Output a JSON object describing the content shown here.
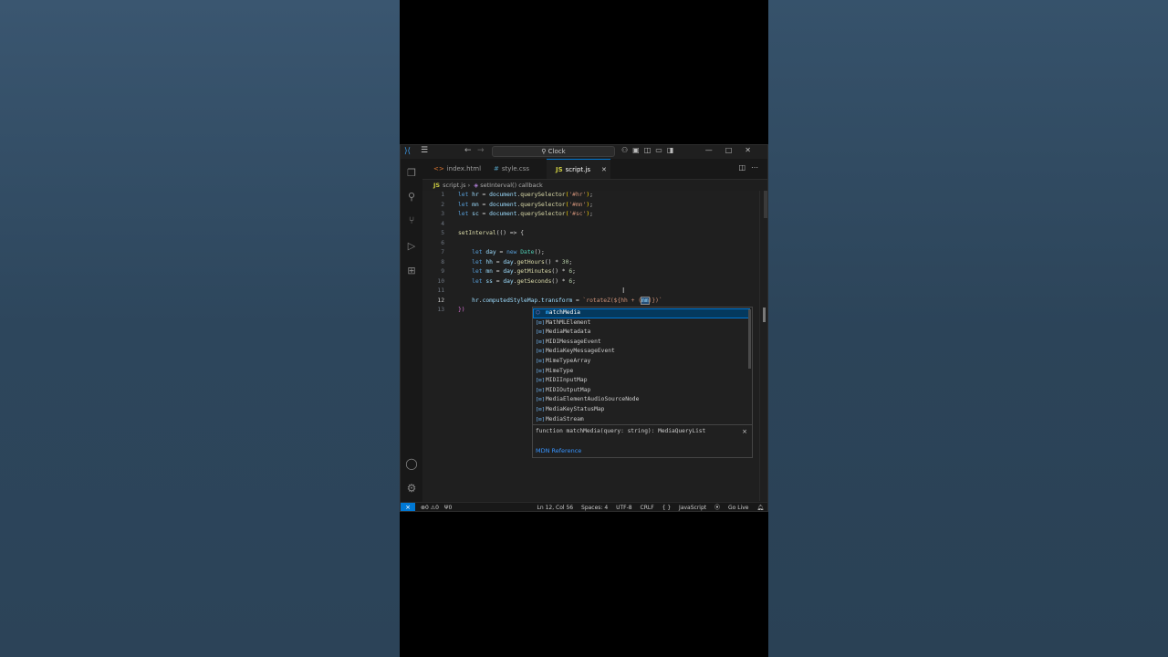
{
  "titlebar": {
    "search_text": "Clock",
    "icons": [
      "vscode-logo",
      "menu-icon",
      "back-arrow",
      "forward-arrow",
      "copilot-icon",
      "layout-icons",
      "window-controls"
    ]
  },
  "tabs": [
    {
      "label": "index.html",
      "glyph": "<>",
      "active": false
    },
    {
      "label": "style.css",
      "glyph": "#",
      "active": false
    },
    {
      "label": "script.js",
      "glyph": "JS",
      "active": true
    }
  ],
  "breadcrumb": {
    "file": "script.js",
    "file_badge": "JS",
    "symbol": "setInterval() callback"
  },
  "editor": {
    "lines": [
      {
        "n": "1"
      },
      {
        "n": "2"
      },
      {
        "n": "3"
      },
      {
        "n": "4"
      },
      {
        "n": "5"
      },
      {
        "n": "6"
      },
      {
        "n": "7"
      },
      {
        "n": "8"
      },
      {
        "n": "9"
      },
      {
        "n": "10"
      },
      {
        "n": "11"
      },
      {
        "n": "12"
      },
      {
        "n": "13"
      }
    ],
    "code": {
      "l1_let": "let",
      "l1_var": "hr",
      "l1_eq": " = ",
      "l1_obj": "document",
      "l1_fn": "querySelector",
      "l1_str": "'#hr'",
      "l2_let": "let",
      "l2_var": "mn",
      "l2_eq": " = ",
      "l2_obj": "document",
      "l2_fn": "querySelector",
      "l2_str": "'#mn'",
      "l3_let": "let",
      "l3_var": "sc",
      "l3_eq": " = ",
      "l3_obj": "document",
      "l3_fn": "querySelector",
      "l3_str": "'#sc'",
      "l5_fn": "setInterval",
      "l5_rest": "(() => {",
      "l7_let": "let",
      "l7_var": "day",
      "l7_new": "new",
      "l7_cls": "Date",
      "l7_end": "();",
      "l8_let": "let",
      "l8_var": "hh",
      "l8_obj": "day",
      "l8_fn": "getHours",
      "l8_num": "30",
      "l9_let": "let",
      "l9_var": "mn",
      "l9_obj": "day",
      "l9_fn": "getMinutes",
      "l9_num": "6",
      "l10_let": "let",
      "l10_var": "ss",
      "l10_obj": "day",
      "l10_fn": "getSeconds",
      "l10_num": "6",
      "l12_obj": "hr",
      "l12_prop": "computedStyleMap",
      "l12_prop2": "transform",
      "l12_str": "`rotateZ(${hh + (",
      "l12_sel": "mm",
      "l12_end": ")})`",
      "l13": "})"
    },
    "current_line": "12"
  },
  "suggestions": {
    "items": [
      {
        "kind": "method",
        "hl": "m",
        "label": "atchMedia",
        "mid_hl": "M",
        "mid": "edia",
        "full": "matchMedia"
      },
      {
        "kind": "field",
        "label": "MathMLElement"
      },
      {
        "kind": "field",
        "label": "MediaMetadata"
      },
      {
        "kind": "field",
        "label": "MIDIMessageEvent"
      },
      {
        "kind": "field",
        "label": "MediaKeyMessageEvent"
      },
      {
        "kind": "field",
        "label": "MimeTypeArray"
      },
      {
        "kind": "field",
        "label": "MimeType"
      },
      {
        "kind": "field",
        "label": "MIDIInputMap"
      },
      {
        "kind": "field",
        "label": "MIDIOutputMap"
      },
      {
        "kind": "field",
        "label": "MediaElementAudioSourceNode"
      },
      {
        "kind": "field",
        "label": "MediaKeyStatusMap"
      },
      {
        "kind": "field",
        "label": "MediaStream"
      }
    ],
    "detail_signature": "function matchMedia(query: string): MediaQueryList",
    "detail_link": "MDN Reference",
    "close_glyph": "×"
  },
  "statusbar": {
    "errors": "0",
    "warnings": "0",
    "ports": "0",
    "position": "Ln 12, Col 56",
    "spaces": "Spaces: 4",
    "encoding": "UTF-8",
    "eol": "CRLF",
    "language": "JavaScript",
    "golive": "Go Live"
  },
  "colors": {
    "accent": "#0078d4",
    "background": "#2f4a61",
    "editor_bg": "#1f1f1f"
  }
}
